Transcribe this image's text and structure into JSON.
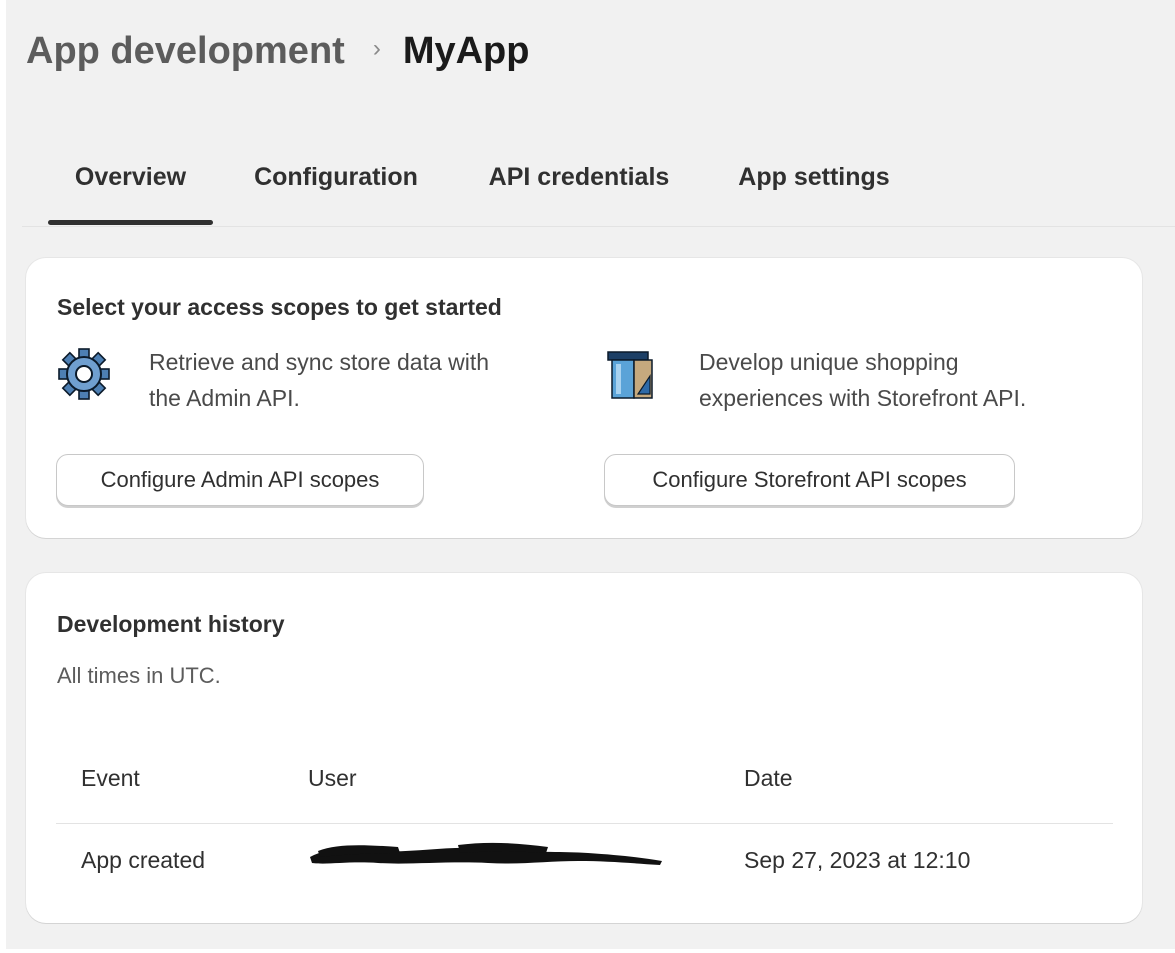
{
  "breadcrumb": {
    "parent": "App development",
    "separator": "›",
    "current": "MyApp"
  },
  "tabs": [
    {
      "label": "Overview",
      "selected": true
    },
    {
      "label": "Configuration",
      "selected": false
    },
    {
      "label": "API credentials",
      "selected": false
    },
    {
      "label": "App settings",
      "selected": false
    }
  ],
  "access_card": {
    "title": "Select your access scopes to get started",
    "admin": {
      "icon": "gear-icon",
      "line1": "Retrieve and sync store data with",
      "line2": "the Admin API.",
      "button": "Configure Admin API scopes"
    },
    "storefront": {
      "icon": "storefront-icon",
      "line1": "Develop unique shopping",
      "line2": "experiences with Storefront API.",
      "button": "Configure Storefront API scopes"
    }
  },
  "history_card": {
    "title": "Development history",
    "subtitle": "All times in UTC.",
    "columns": [
      "Event",
      "User",
      "Date"
    ],
    "rows": [
      {
        "event": "App created",
        "user": "[redacted]",
        "date": "Sep 27, 2023 at 12:10"
      }
    ]
  },
  "colors": {
    "page_background": "#f1f1f1",
    "card_background": "#ffffff",
    "text_primary": "#303030",
    "tab_indicator": "#303030"
  }
}
